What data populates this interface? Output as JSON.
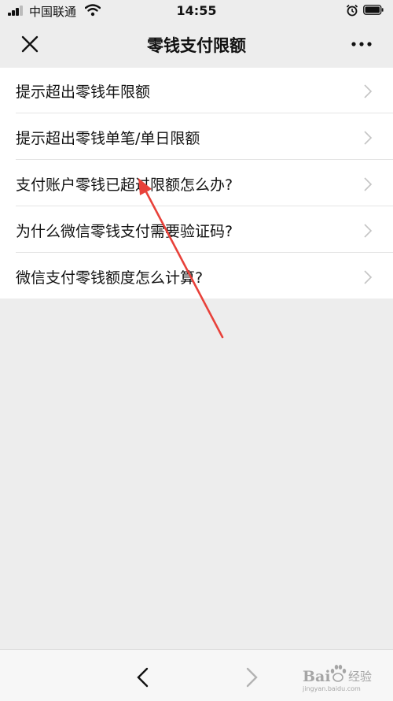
{
  "status_bar": {
    "carrier": "中国联通",
    "time": "14:55",
    "icons": [
      "signal-icon",
      "wifi-icon",
      "alarm-icon",
      "battery-icon"
    ]
  },
  "nav": {
    "title": "零钱支付限额",
    "close_icon": "close-icon",
    "more_icon": "more-icon"
  },
  "list": {
    "items": [
      {
        "label": "提示超出零钱年限额"
      },
      {
        "label": "提示超出零钱单笔/单日限额"
      },
      {
        "label": "支付账户零钱已超过限额怎么办?"
      },
      {
        "label": "为什么微信零钱支付需要验证码?"
      },
      {
        "label": "微信支付零钱额度怎么计算?"
      }
    ]
  },
  "bottom_bar": {
    "back_icon": "chevron-left-icon",
    "forward_icon": "chevron-right-icon"
  },
  "watermark": {
    "brand": "Bai",
    "sub": "经验",
    "url": "jingyan.baidu.com"
  },
  "colors": {
    "background": "#ededed",
    "list_background": "#ffffff",
    "annotation_arrow": "#e8413a",
    "chevron": "#c4c4c4"
  }
}
